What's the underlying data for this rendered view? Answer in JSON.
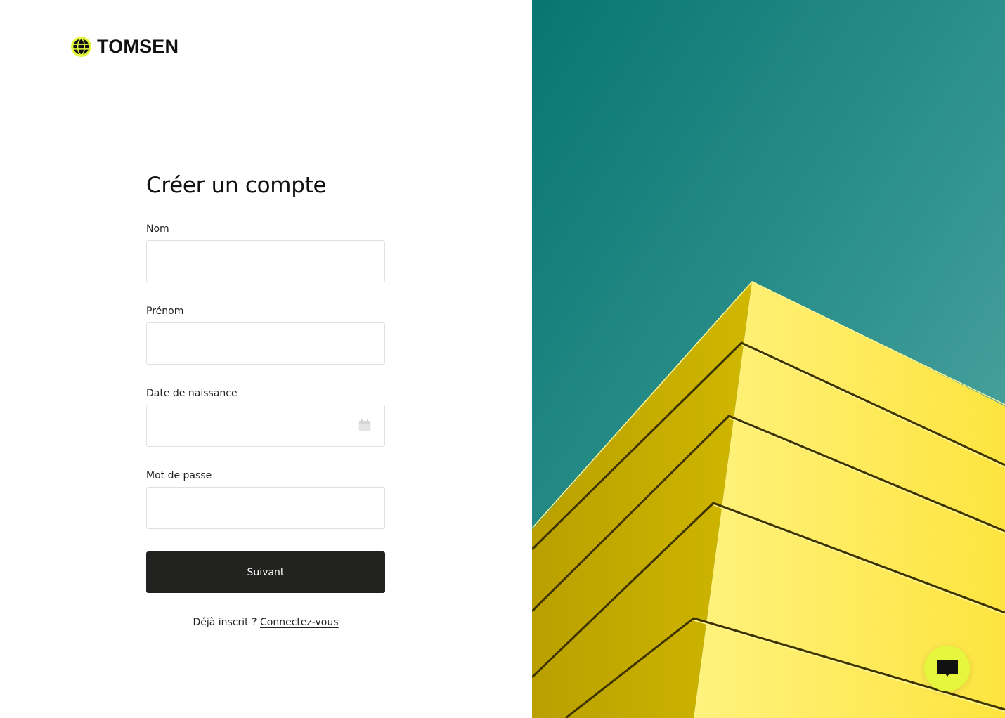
{
  "brand": {
    "name": "TOMSEN",
    "logo_icon": "globe-icon",
    "accent": "#E6F63C"
  },
  "form": {
    "title": "Créer un compte",
    "fields": [
      {
        "label": "Nom",
        "value": "",
        "type": "text"
      },
      {
        "label": "Prénom",
        "value": "",
        "type": "text"
      },
      {
        "label": "Date de naissance",
        "value": "",
        "type": "date",
        "icon": "calendar-icon"
      },
      {
        "label": "Mot de passe",
        "value": "",
        "type": "password"
      }
    ],
    "submit_label": "Suivant",
    "login_prompt": "Déjà inscrit ?",
    "login_link": "Connectez-vous"
  },
  "hero": {
    "sky_color": "#1E8C88",
    "building_color": "#F4E44A"
  },
  "chat": {
    "icon": "chat-icon"
  }
}
